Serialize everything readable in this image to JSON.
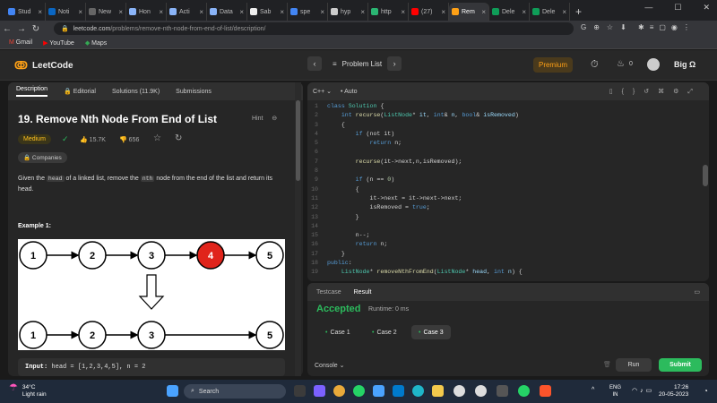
{
  "browser": {
    "tabs": [
      {
        "label": "Stud",
        "color": "#4285f4"
      },
      {
        "label": "Noti",
        "color": "#0a66c2"
      },
      {
        "label": "New",
        "color": "#666"
      },
      {
        "label": "Hon",
        "color": "#8ab4f8"
      },
      {
        "label": "Acti",
        "color": "#8ab4f8"
      },
      {
        "label": "Data",
        "color": "#8ab4f8"
      },
      {
        "label": "Sab",
        "color": "#eee"
      },
      {
        "label": "spe",
        "color": "#4285f4"
      },
      {
        "label": "hyp",
        "color": "#ccc"
      },
      {
        "label": "http",
        "color": "#2bb673"
      },
      {
        "label": "(27)",
        "color": "#ff0000"
      },
      {
        "label": "Rem",
        "color": "#ffa116"
      },
      {
        "label": "Dele",
        "color": "#0f9d58"
      },
      {
        "label": "Dele",
        "color": "#0f9d58"
      }
    ],
    "active_tab_index": 11,
    "new_tab": "+",
    "url_host": "leetcode.com",
    "url_path": "/problems/remove-nth-node-from-end-of-list/description/",
    "bookmarks": [
      "Gmail",
      "YouTube",
      "Maps"
    ]
  },
  "header": {
    "logo": "LeetCode",
    "problem_list": "Problem List",
    "premium": "Premium",
    "fire_count": "0",
    "user": "Big Ω"
  },
  "description": {
    "tabs": [
      "Description",
      "Editorial",
      "Solutions (11.9K)",
      "Submissions"
    ],
    "title": "19. Remove Nth Node From End of List",
    "hint": "Hint",
    "difficulty": "Medium",
    "likes": "15.7K",
    "dislikes": "656",
    "companies": "Companies",
    "desc_1": "Given the ",
    "desc_code1": "head",
    "desc_2": " of a linked list, remove the ",
    "desc_code2": "nth",
    "desc_3": " node from the end of the list and return its head.",
    "example_title": "Example 1:",
    "top_nodes": [
      "1",
      "2",
      "3",
      "4",
      "5"
    ],
    "bottom_nodes": [
      "1",
      "2",
      "3",
      "5"
    ],
    "input_label": "Input:",
    "input_value": "head = [1,2,3,4,5], n = 2"
  },
  "editor": {
    "language": "C++",
    "mode": "Auto"
  },
  "result": {
    "tabs": [
      "Testcase",
      "Result"
    ],
    "status": "Accepted",
    "runtime": "Runtime: 0 ms",
    "cases": [
      "Case 1",
      "Case 2",
      "Case 3"
    ],
    "console": "Console",
    "run": "Run",
    "submit": "Submit"
  },
  "taskbar": {
    "temp": "34°C",
    "weather": "Light rain",
    "search": "Search",
    "lang": "ENG",
    "region": "IN",
    "time": "17:26",
    "date": "20-05-2023"
  }
}
